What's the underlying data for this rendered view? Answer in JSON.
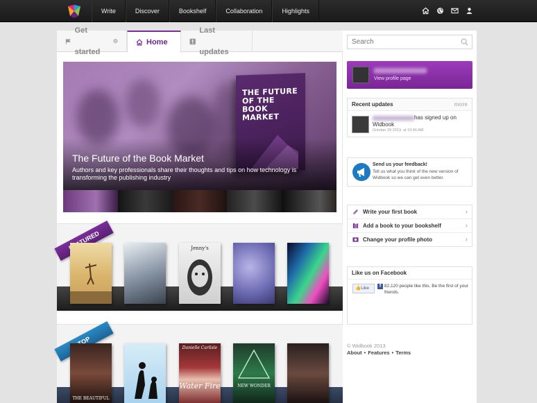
{
  "nav": {
    "items": [
      "Write",
      "Discover",
      "Bookshelf",
      "Collaboration",
      "Highlights"
    ],
    "icons": [
      "home-icon",
      "globe-icon",
      "mail-icon",
      "user-icon"
    ]
  },
  "tabs": [
    {
      "label": "Get started",
      "icon": "flag-icon",
      "active": false
    },
    {
      "label": "Home",
      "icon": "home-icon",
      "active": true
    },
    {
      "label": "Last updates",
      "icon": "alert-icon",
      "active": false
    }
  ],
  "hero": {
    "title": "The Future of the Book Market",
    "description": "Authors and key professionals share their thoughts and tips on how technology is transforming the publishing industry",
    "book_cover_text": "THE FUTURE OF THE BOOK MARKET"
  },
  "shelves": {
    "featured_label": "FEATURED",
    "top_label": "TOP",
    "top_book_texts": [
      "THE BEAUTIFUL",
      "",
      "Water Fire",
      "NEW WONDER",
      ""
    ],
    "top_author_text": "Danielle Carlisle"
  },
  "sidebar": {
    "search_placeholder": "Search",
    "profile_link": "View profile page",
    "recent_updates": {
      "title": "Recent updates",
      "more": "more",
      "text_line1": "has signed up on",
      "text_line2": "Widbook",
      "time": "October 29 2013, at 10:46 AM"
    },
    "feedback": {
      "title": "Send us your feedback!",
      "text": "Tell us what you think of the new version of Widbook so we can get even better."
    },
    "actions": [
      {
        "label": "Write your first book",
        "icon": "pencil-icon"
      },
      {
        "label": "Add a book to your bookshelf",
        "icon": "books-icon"
      },
      {
        "label": "Change your profile photo",
        "icon": "photo-icon"
      }
    ],
    "facebook": {
      "title": "Like us on Facebook",
      "like_button": "Like",
      "text": "82,120 people like this. Be the first of your friends."
    },
    "copyright": "© Widbook 2013",
    "footer_links": [
      "About",
      "Features",
      "Terms"
    ]
  },
  "colors": {
    "accent": "#7a2e9a",
    "topbar": "#222222",
    "facebook": "#3b5998"
  }
}
